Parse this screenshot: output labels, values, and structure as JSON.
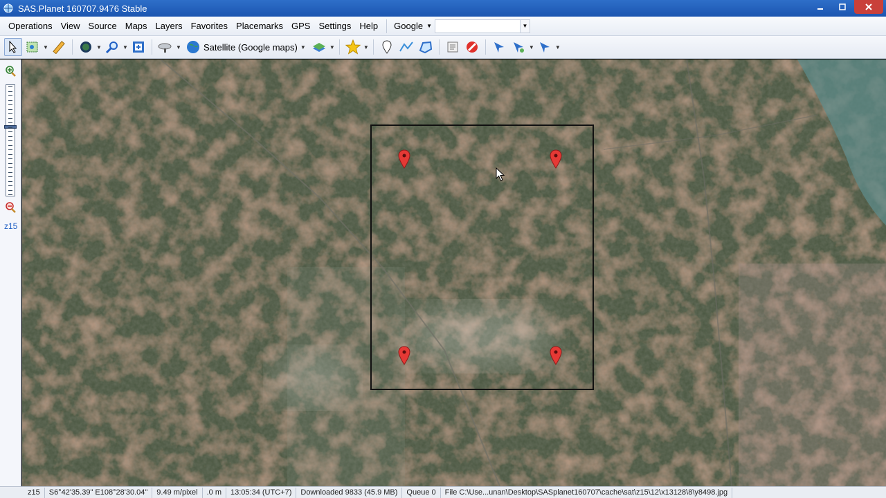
{
  "window": {
    "title": "SAS.Planet 160707.9476 Stable"
  },
  "menu": {
    "items": [
      "Operations",
      "View",
      "Source",
      "Maps",
      "Layers",
      "Favorites",
      "Placemarks",
      "GPS",
      "Settings",
      "Help"
    ],
    "source_select": "Google",
    "search_value": ""
  },
  "toolbar": {
    "map_type": "Satellite (Google maps)",
    "icons": [
      "select-arrow-icon",
      "selection-area-icon",
      "ruler-icon",
      "globe-icon",
      "zoom-tool-icon",
      "fullscreen-icon",
      "satellite-dish-icon",
      "map-globe-icon",
      "layers-icon",
      "favorites-star-icon",
      "placemark-pin-icon",
      "path-icon",
      "polygon-icon",
      "placemark-list-icon",
      "delete-icon",
      "gps-arrow-icon",
      "gps-track-icon",
      "gps-center-icon"
    ]
  },
  "zoom": {
    "level_label": "z15",
    "level": 15,
    "max_level": 24
  },
  "map": {
    "placemarks": [
      {
        "name": "placemark-top-left"
      },
      {
        "name": "placemark-top-right"
      },
      {
        "name": "placemark-bottom-left"
      },
      {
        "name": "placemark-bottom-right"
      }
    ]
  },
  "status": {
    "zoom": "z15",
    "coords": "S6°42'35.39\" E108°28'30.04\"",
    "scale": "9.49 m/pixel",
    "altitude": ".0 m",
    "time": "13:05:34 (UTC+7)",
    "downloaded": "Downloaded 9833 (45.9 MB)",
    "queue": "Queue 0",
    "file": "File C:\\Use...unan\\Desktop\\SASplanet160707\\cache\\sat\\z15\\12\\x13128\\8\\y8498.jpg"
  },
  "colors": {
    "titlebar": "#1b55b0",
    "close": "#c9403a",
    "marker": "#e53935",
    "zoom_label": "#1f5fc4"
  }
}
